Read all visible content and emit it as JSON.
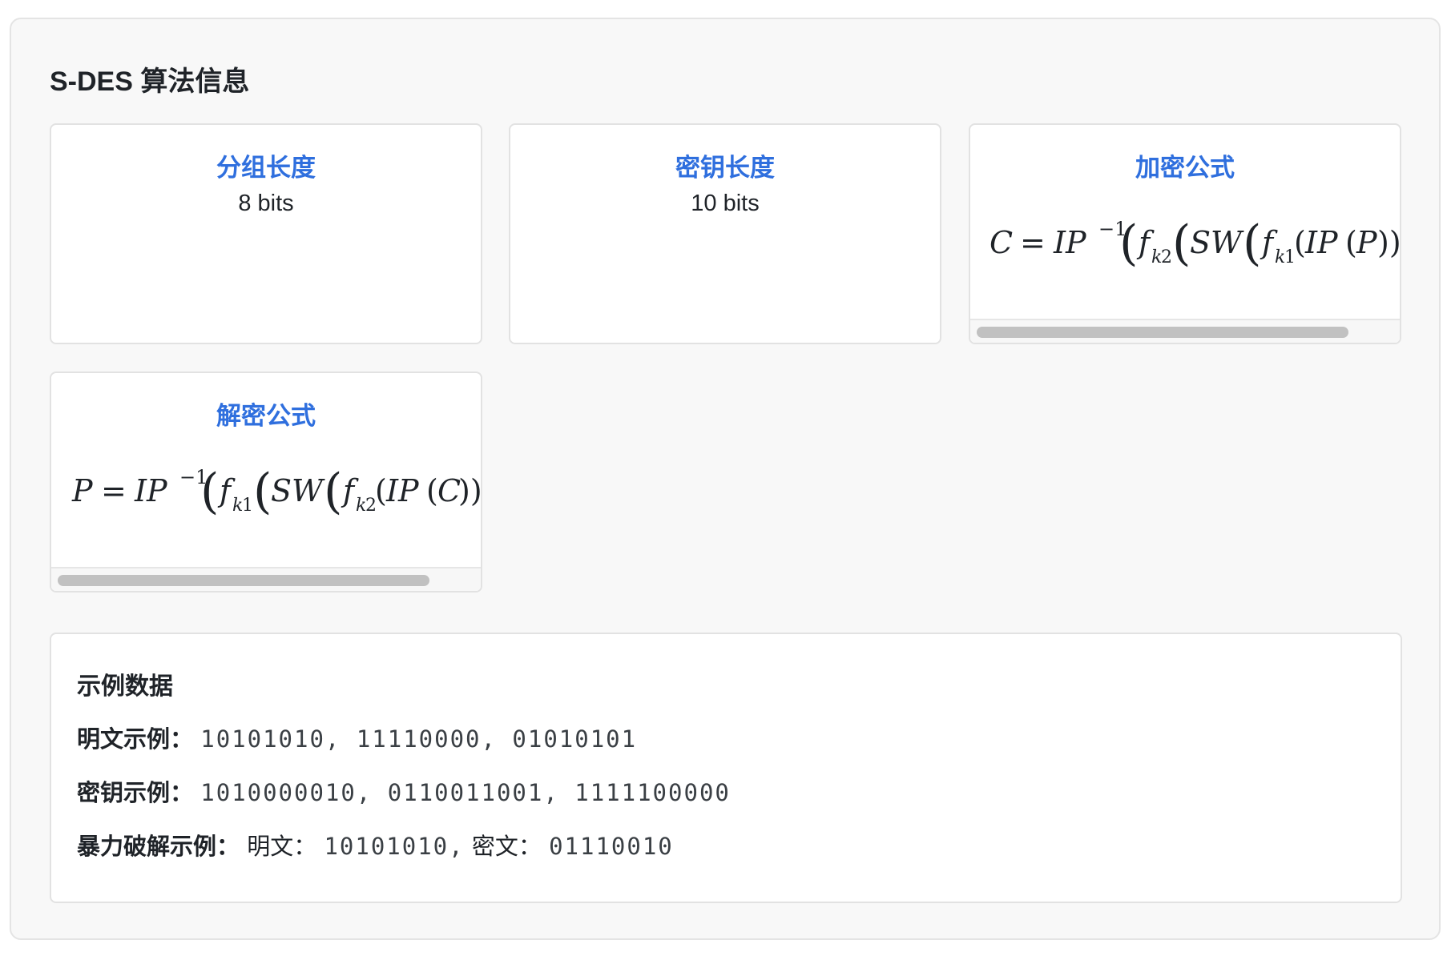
{
  "section": {
    "title": "S-DES 算法信息"
  },
  "cards": {
    "block_length": {
      "title": "分组长度",
      "value": "8 bits"
    },
    "key_length": {
      "title": "密钥长度",
      "value": "10 bits"
    },
    "encrypt_formula": {
      "title": "加密公式",
      "formula": "C = IP^{-1}(f_{k2}(SW(f_{k1}(IP(P))",
      "tokens": {
        "lhs": "C",
        "ip": "IP",
        "inv": "−1",
        "f": "f",
        "k": "k",
        "two": "2",
        "one": "1",
        "sw": "SW",
        "arg": "P"
      }
    },
    "decrypt_formula": {
      "title": "解密公式",
      "formula": "P = IP^{-1}(f_{k1}(SW(f_{k2}(IP(C))",
      "tokens": {
        "lhs": "P",
        "ip": "IP",
        "inv": "−1",
        "f": "f",
        "k": "k",
        "two": "2",
        "one": "1",
        "sw": "SW",
        "arg": "C"
      }
    }
  },
  "examples": {
    "title": "示例数据",
    "plaintext_label": "明文示例：",
    "plaintext_values": "10101010, 11110000, 01010101",
    "key_label": "密钥示例：",
    "key_values": "1010000010, 0110011001, 1111100000",
    "bruteforce_label": "暴力破解示例：",
    "bruteforce_plain_label": "明文：",
    "bruteforce_plain_value": "10101010,",
    "bruteforce_cipher_label": "密文：",
    "bruteforce_cipher_value": "01110010"
  },
  "colors": {
    "accent": "#2f6fde",
    "panel_bg": "#f8f8f8",
    "border": "#e2e2e2",
    "scroll_thumb": "#c1c1c1"
  }
}
